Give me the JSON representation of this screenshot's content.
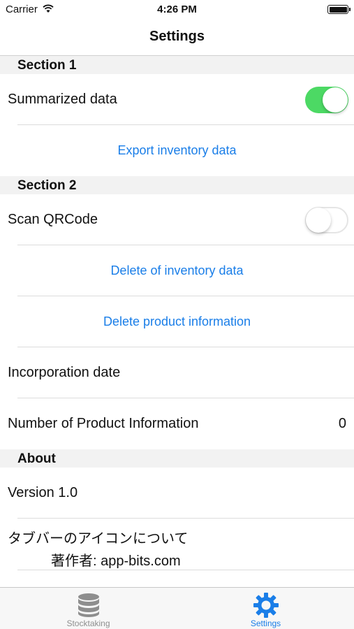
{
  "status_bar": {
    "carrier": "Carrier",
    "time": "4:26 PM",
    "wifi_icon": "wifi-icon",
    "battery_icon": "battery-icon"
  },
  "nav": {
    "title": "Settings"
  },
  "sections": {
    "s1": {
      "header": "Section 1",
      "summarized_label": "Summarized data",
      "summarized_on": true,
      "export_label": "Export inventory data"
    },
    "s2": {
      "header": "Section 2",
      "scan_label": "Scan QRCode",
      "scan_on": false,
      "delete_inventory_label": "Delete of inventory data",
      "delete_product_label": "Delete product information",
      "incorporation_label": "Incorporation date",
      "product_count_label": "Number of Product Information",
      "product_count_value": "0"
    },
    "about": {
      "header": "About",
      "version_label": "Version 1.0",
      "icon_credit_line1": "タブバーのアイコンについて",
      "icon_credit_line2": "著作者: app-bits.com"
    }
  },
  "tab_bar": {
    "tabs": [
      {
        "label": "Stocktaking",
        "icon": "database-icon",
        "selected": false
      },
      {
        "label": "Settings",
        "icon": "gear-icon",
        "selected": true
      }
    ]
  },
  "colors": {
    "accent": "#1a7ee8",
    "toggle_on": "#4cd964",
    "section_bg": "#f2f2f2",
    "tab_inactive": "#8e8e8e"
  }
}
